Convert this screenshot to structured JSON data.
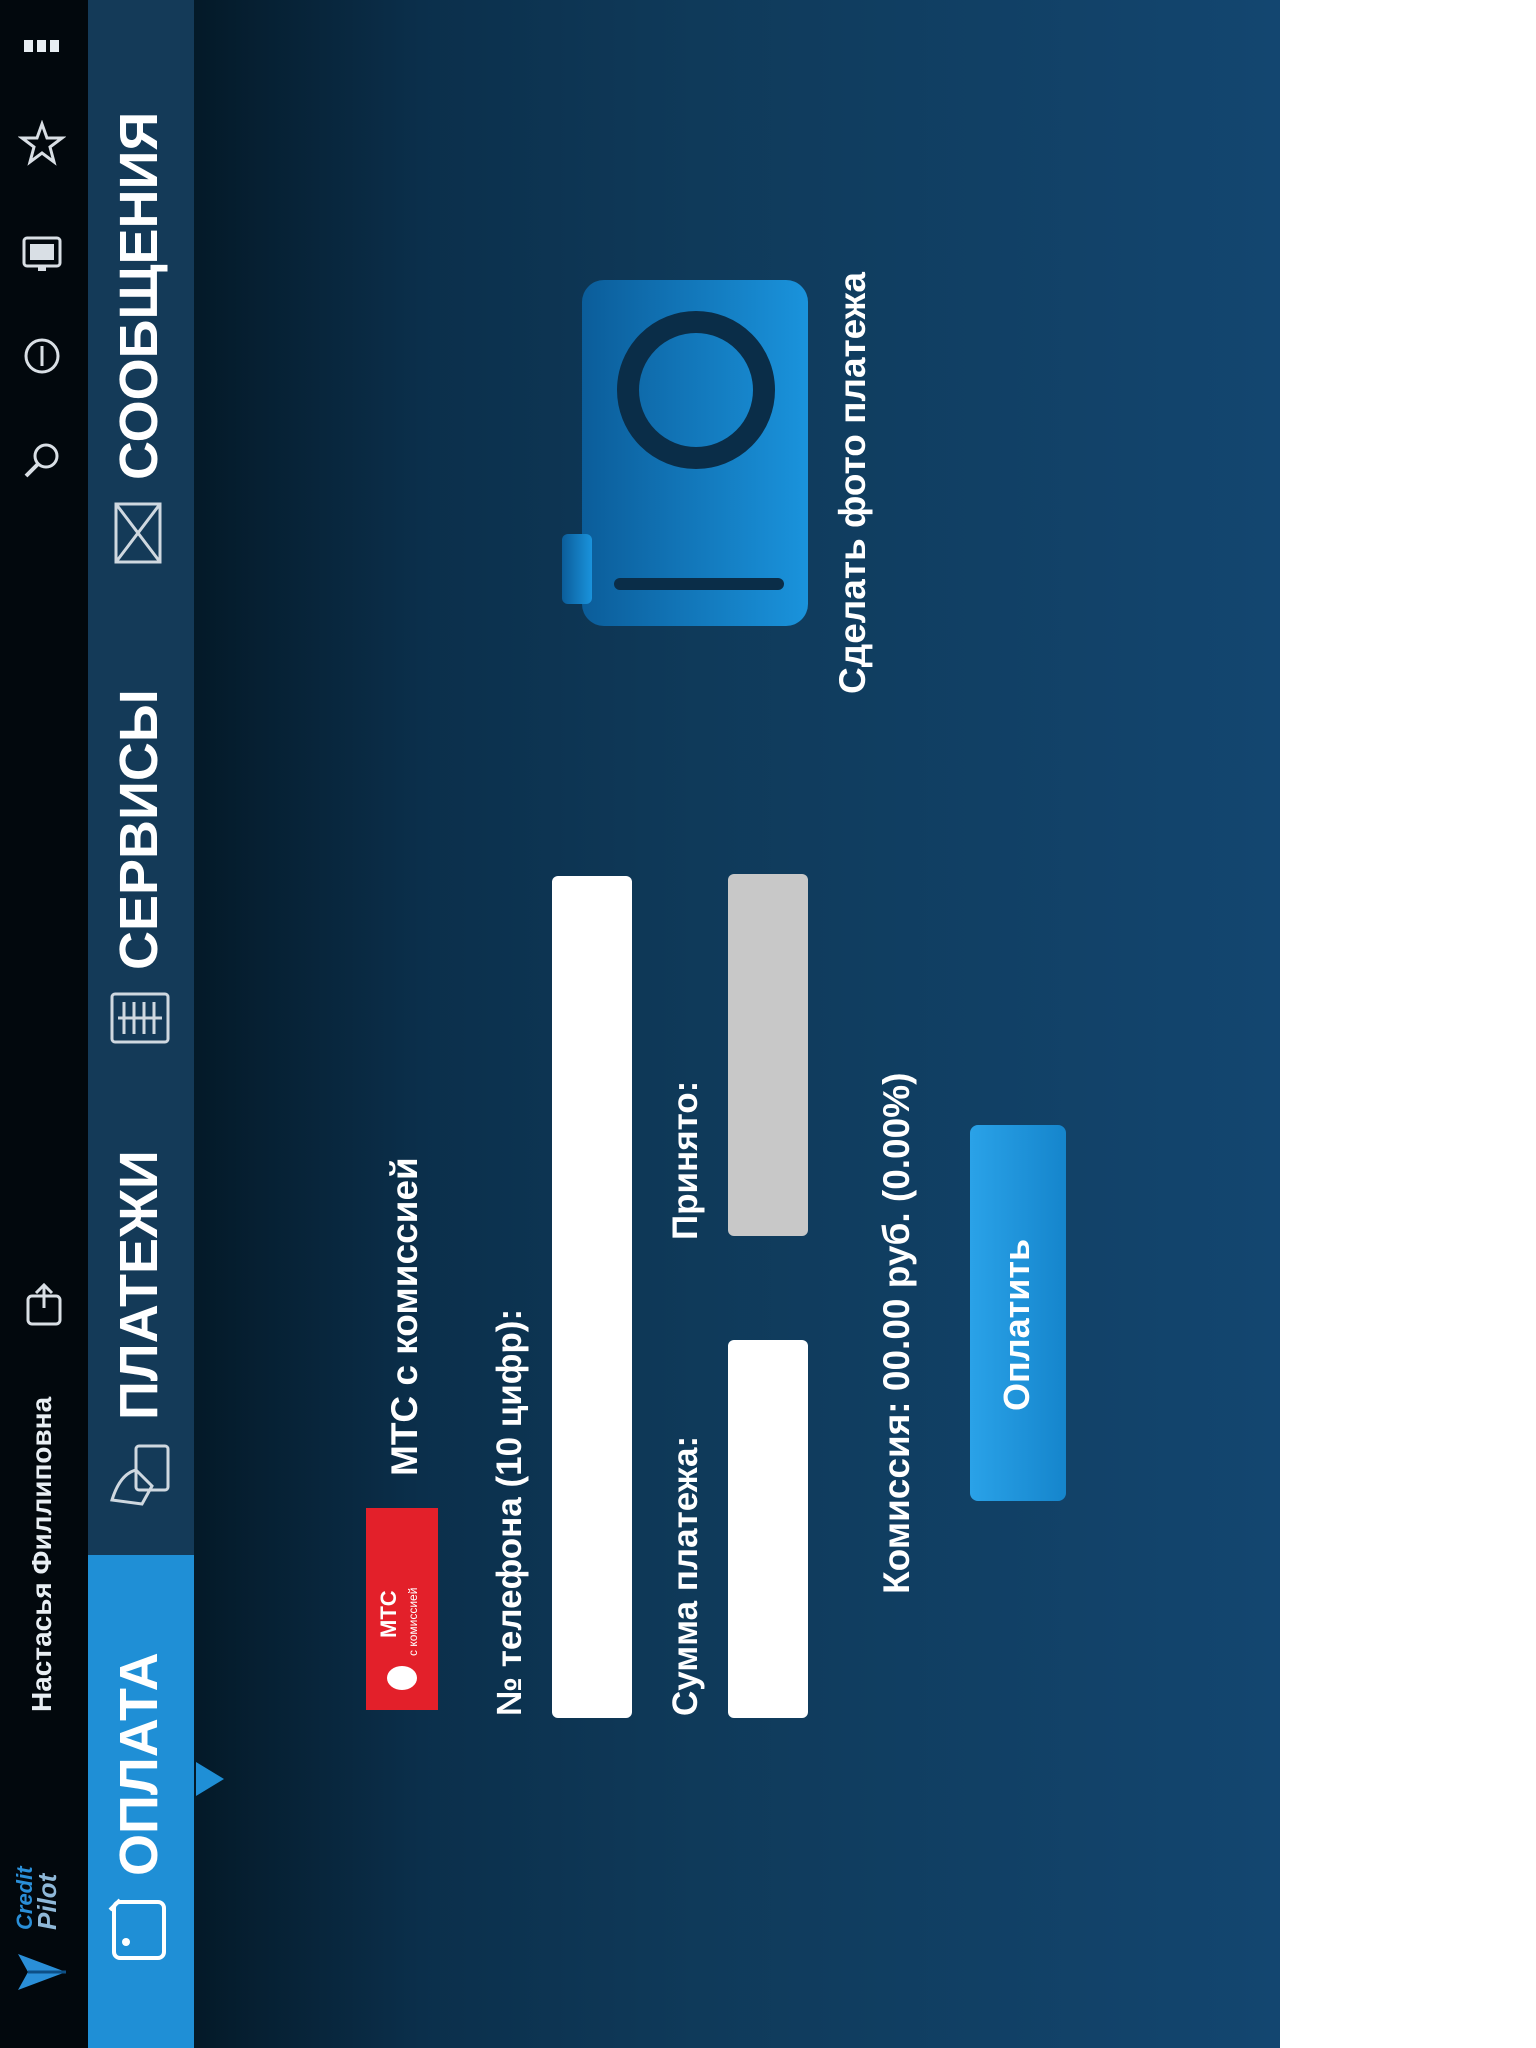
{
  "status_bar": {
    "user_name": "Настасья Филлиповна",
    "brand_line1": "Credit",
    "brand_line2": "Pilot"
  },
  "nav": {
    "tabs": [
      {
        "label": "ОПЛАТА",
        "active": true
      },
      {
        "label": "ПЛАТЕЖИ",
        "active": false
      },
      {
        "label": "СЕРВИСЫ",
        "active": false
      },
      {
        "label": "СООБЩЕНИЯ",
        "active": false
      }
    ]
  },
  "provider": {
    "logo_text": "МТС",
    "logo_subtext": "с комиссией",
    "name": "МТС с комиссией"
  },
  "form": {
    "phone_label": "№ телефона (10 цифр):",
    "phone_value": "",
    "amount_label": "Сумма платежа:",
    "amount_value": "",
    "accepted_label": "Принято:",
    "accepted_value": "",
    "commission_text": "Комиссия: 00.00 руб. (0.00%)",
    "pay_button": "Оплатить"
  },
  "camera": {
    "caption": "Сделать фото платежа"
  },
  "colors": {
    "accent": "#1f8fd6",
    "nav_bg": "#143a58",
    "logo_red": "#e3202a"
  }
}
